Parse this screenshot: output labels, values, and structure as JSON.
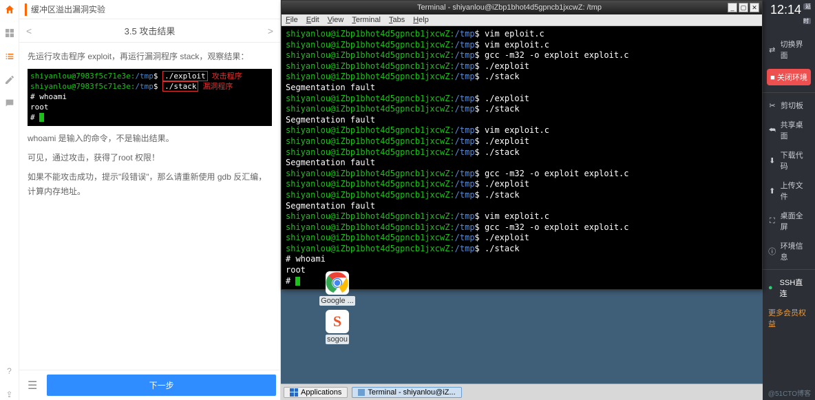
{
  "header": {
    "title": "缓冲区溢出漏洞实验"
  },
  "section": {
    "title": "3.5 攻击结果",
    "prev": "<",
    "next": ">"
  },
  "instructions": {
    "line1": "先运行攻击程序 exploit，再运行漏洞程序 stack，观察结果：",
    "after1": "whoami 是输入的命令，不是输出结果。",
    "after2": "可见，通过攻击，获得了root 权限！",
    "after3": "如果不能攻击成功，提示\"段错误\"，那么请重新使用 gdb 反汇编，计算内存地址。"
  },
  "mini_term": {
    "l1_prompt": "shiyanlou@7983f5c71e3e:",
    "l1_path": "/tmp",
    "l1_cmd": "./exploit",
    "l1_anno": "攻击程序",
    "l2_prompt": "shiyanlou@7983f5c71e3e:",
    "l2_path": "/tmp",
    "l2_cmd": "./stack",
    "l2_anno": "漏洞程序",
    "l3": "# whoami",
    "l4": "root",
    "l5": "# "
  },
  "footer": {
    "next": "下一步"
  },
  "terminal": {
    "title": "Terminal - shiyanlou@iZbp1bhot4d5gpncb1jxcwZ: /tmp",
    "menu": [
      "File",
      "Edit",
      "View",
      "Terminal",
      "Tabs",
      "Help"
    ],
    "prompt": "shiyanlou@iZbp1bhot4d5gpncb1jxcwZ:",
    "path": "/tmp",
    "lines": [
      {
        "cmd": "vim eploit.c"
      },
      {
        "cmd": "vim exploit.c"
      },
      {
        "cmd": "gcc -m32 -o exploit exploit.c"
      },
      {
        "cmd": "./exploit"
      },
      {
        "cmd": "./stack"
      },
      {
        "out": "Segmentation fault"
      },
      {
        "cmd": "./exploit"
      },
      {
        "cmd": "./stack"
      },
      {
        "out": "Segmentation fault"
      },
      {
        "cmd": "vim exploit.c"
      },
      {
        "cmd": "./exploit"
      },
      {
        "cmd": "./stack"
      },
      {
        "out": "Segmentation fault"
      },
      {
        "cmd": "gcc -m32 -o exploit exploit.c"
      },
      {
        "cmd": "./exploit"
      },
      {
        "cmd": "./stack"
      },
      {
        "out": "Segmentation fault"
      },
      {
        "cmd": "vim exploit.c"
      },
      {
        "cmd": "gcc -m32 -o exploit exploit.c"
      },
      {
        "cmd": "./exploit"
      },
      {
        "cmd": "./stack"
      },
      {
        "raw": "# whoami"
      },
      {
        "raw": "root"
      },
      {
        "raw": "# ",
        "cursor": true
      }
    ]
  },
  "desktop_icons": {
    "chrome": "Google ...",
    "sogou": "sogou"
  },
  "taskbar": {
    "apps": "Applications",
    "term": "Terminal - shiyanlou@iZ..."
  },
  "rightbar": {
    "time": "12:14",
    "badge": "延时",
    "switch_ui": "切换界面",
    "close_env": "关闭环境",
    "items": [
      {
        "icon": "✂",
        "label": "剪切板"
      },
      {
        "icon": "⮪",
        "label": "共享桌面"
      },
      {
        "icon": "⬇",
        "label": "下载代码"
      },
      {
        "icon": "⬆",
        "label": "上传文件"
      },
      {
        "icon": "⛶",
        "label": "桌面全屏"
      },
      {
        "icon": "ⓘ",
        "label": "环境信息"
      }
    ],
    "ssh": "SSH直连",
    "more": "更多会员权益"
  },
  "watermark": "@51CTO博客"
}
